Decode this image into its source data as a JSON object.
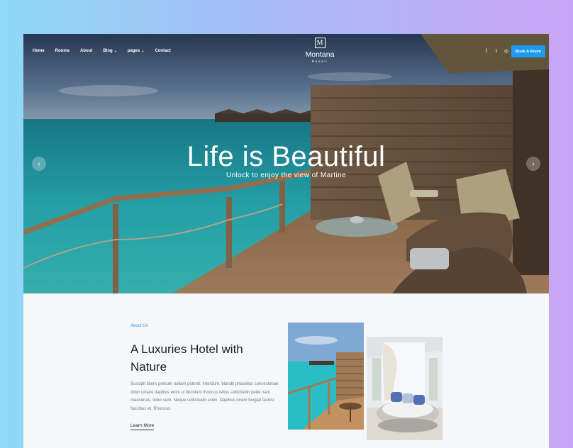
{
  "nav": {
    "items": [
      {
        "label": "Home",
        "caret": ""
      },
      {
        "label": "Rooms",
        "caret": ""
      },
      {
        "label": "About",
        "caret": ""
      },
      {
        "label": "Blog",
        "caret": "⌄"
      },
      {
        "label": "pages",
        "caret": "⌄"
      },
      {
        "label": "Contact",
        "caret": ""
      }
    ]
  },
  "logo": {
    "letter": "M",
    "name": "Montana",
    "sub": "Resort"
  },
  "social": {
    "facebook": "f",
    "twitter": "t",
    "instagram": "◎"
  },
  "book_button": "Book A Room",
  "hero": {
    "title": "Life is Beautiful",
    "subtitle": "Unlock to enjoy the view of Martine",
    "prev_arrow": "‹",
    "next_arrow": "›"
  },
  "about": {
    "tag": "About Us",
    "title": "A Luxuries Hotel with Nature",
    "text": "Suscipit libero pretium nullam potenti. Interdum, blandit phasellus consectetuer dolor ornare dapibus enim ut tincidunt rhoncus tellus sollicitudin pede nam maecenas, dolor sem. Neque sollicitudin enim. Dapibus lorem feugiat facilisi faucibus et. Rhoncus.",
    "learn_more": "Learn More"
  },
  "colors": {
    "accent": "#1e9bf0",
    "background": "#f6f7f9"
  }
}
